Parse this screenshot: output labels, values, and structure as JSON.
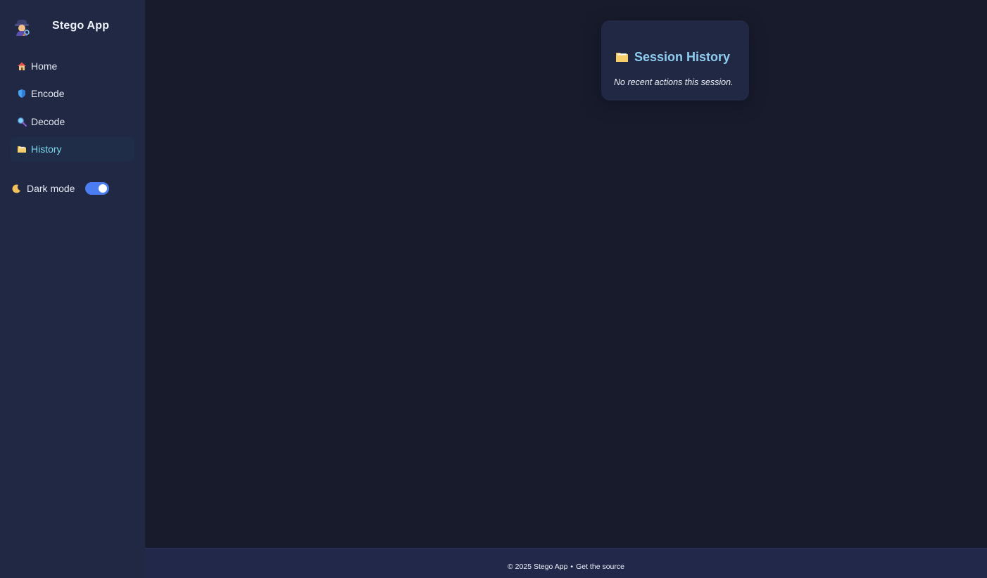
{
  "sidebar": {
    "brand": {
      "title": "Stego App",
      "logo_icon": "detective-icon"
    },
    "nav": [
      {
        "label": "Home",
        "icon": "house-icon",
        "active": false
      },
      {
        "label": "Encode",
        "icon": "shield-icon",
        "active": false
      },
      {
        "label": "Decode",
        "icon": "magnifier-icon",
        "active": false
      },
      {
        "label": "History",
        "icon": "folder-icon",
        "active": true
      }
    ],
    "dark_mode": {
      "label": "Dark mode",
      "icon": "moon-icon",
      "enabled": true
    }
  },
  "history_card": {
    "title": "Session History",
    "icon": "folder-icon",
    "empty_text": "No recent actions this session."
  },
  "footer": {
    "copyright": "© 2025 Stego App",
    "separator": "•",
    "source_link": "Get the source"
  },
  "colors": {
    "background": "#181b2b",
    "sidebar": "#212843",
    "active_nav_bg": "#1f2d48",
    "active_nav_text": "#7fd6ee",
    "card_title": "#8ecdf0",
    "toggle_on": "#4a7ef0"
  }
}
